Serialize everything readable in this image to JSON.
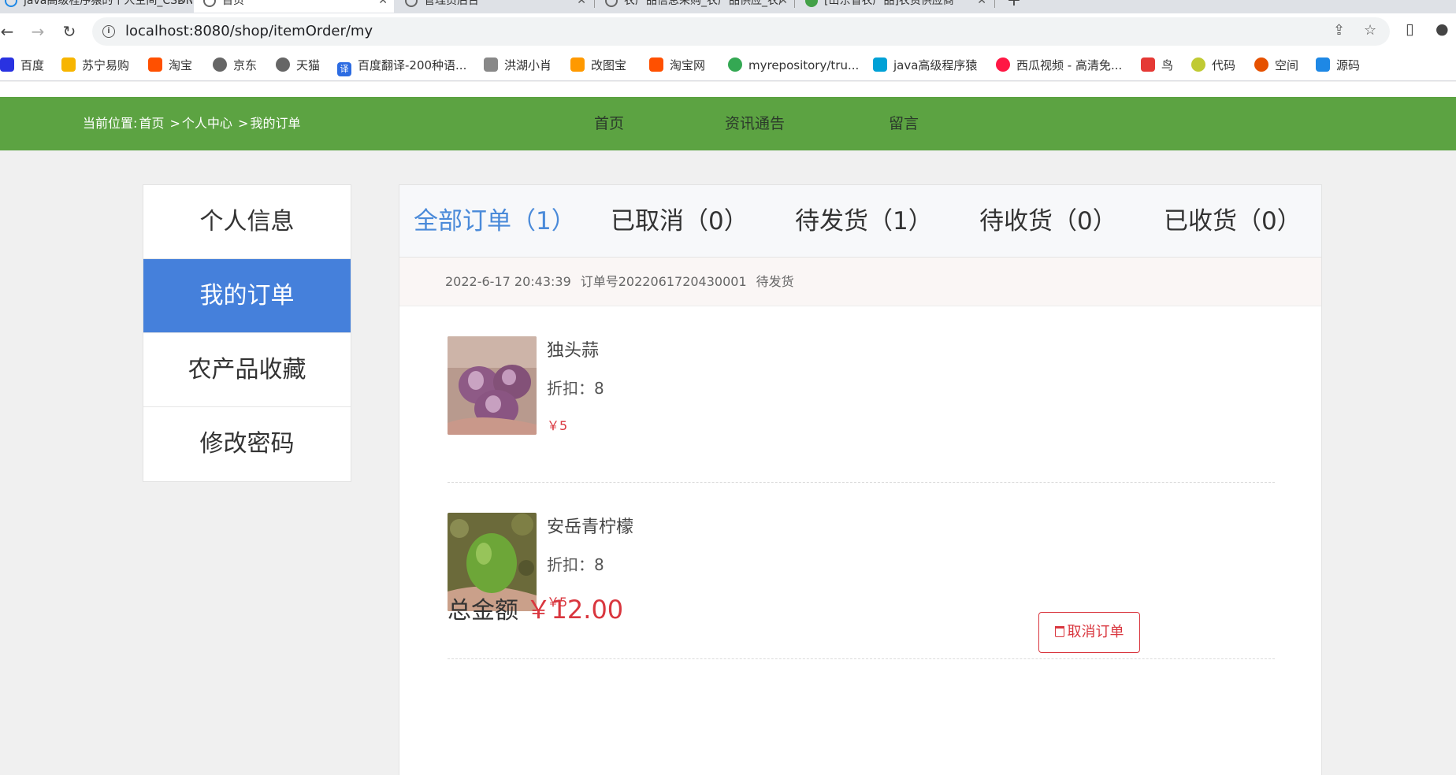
{
  "browser": {
    "tabs": [
      {
        "title": "java高级程序猿的个人空间_CSDN"
      },
      {
        "title": "首页"
      },
      {
        "title": "管理员后台"
      },
      {
        "title": "农产品信息采购_农产品供应_农产"
      },
      {
        "title": "[山东省农产品]农资供应商"
      }
    ],
    "url": "localhost:8080/shop/itemOrder/my",
    "bookmarks": [
      {
        "label": "百度",
        "color": "#2932e1"
      },
      {
        "label": "苏宁易购",
        "color": "#f7b500"
      },
      {
        "label": "淘宝",
        "color": "#ff5000"
      },
      {
        "label": "京东",
        "color": "#666666"
      },
      {
        "label": "天猫",
        "color": "#666666"
      },
      {
        "label": "百度翻译-200种语...",
        "color": "#2d6ce2"
      },
      {
        "label": "洪湖小肖",
        "color": "#888888"
      },
      {
        "label": "改图宝",
        "color": "#ff9900"
      },
      {
        "label": "淘宝网",
        "color": "#ff5000"
      },
      {
        "label": "myrepository/tru...",
        "color": "#34a853"
      },
      {
        "label": "java高级程序猿",
        "color": "#00a1d6"
      },
      {
        "label": "西瓜视频 - 高清免...",
        "color": "#ff1744"
      },
      {
        "label": "鸟",
        "color": "#e53935"
      },
      {
        "label": "代码",
        "color": "#c0ca33"
      },
      {
        "label": "空间",
        "color": "#e65100"
      },
      {
        "label": "源码",
        "color": "#1e88e5"
      }
    ]
  },
  "header": {
    "breadcrumb_prefix": "当前位置:",
    "breadcrumb_home": "首页",
    "breadcrumb_sep1": " >",
    "breadcrumb_center": "个人中心",
    "breadcrumb_sep2": " >",
    "breadcrumb_current": "我的订单",
    "nav": [
      "首页",
      "资讯通告",
      "留言"
    ]
  },
  "sidebar": {
    "items": [
      {
        "label": "个人信息"
      },
      {
        "label": "我的订单"
      },
      {
        "label": "农产品收藏"
      },
      {
        "label": "修改密码"
      }
    ]
  },
  "order_tabs": [
    {
      "label": "全部订单（1）"
    },
    {
      "label": "已取消（0）"
    },
    {
      "label": "待发货（1）"
    },
    {
      "label": "待收货（0）"
    },
    {
      "label": "已收货（0）"
    }
  ],
  "order": {
    "time": "2022-6-17 20:43:39",
    "number": "订单号2022061720430001",
    "status": "待发货",
    "items": [
      {
        "name": "独头蒜",
        "discount": "折扣：8",
        "price": "￥5"
      },
      {
        "name": "安岳青柠檬",
        "discount": "折扣：8",
        "price": "￥5"
      }
    ],
    "total_label": "总金额",
    "total_amount": "￥12.00",
    "cancel_label": "取消订单"
  },
  "colors": {
    "header_green": "#5ca342",
    "active_blue": "#4580db",
    "tab_active": "#4a8ad9",
    "price_red": "#d9363e"
  }
}
